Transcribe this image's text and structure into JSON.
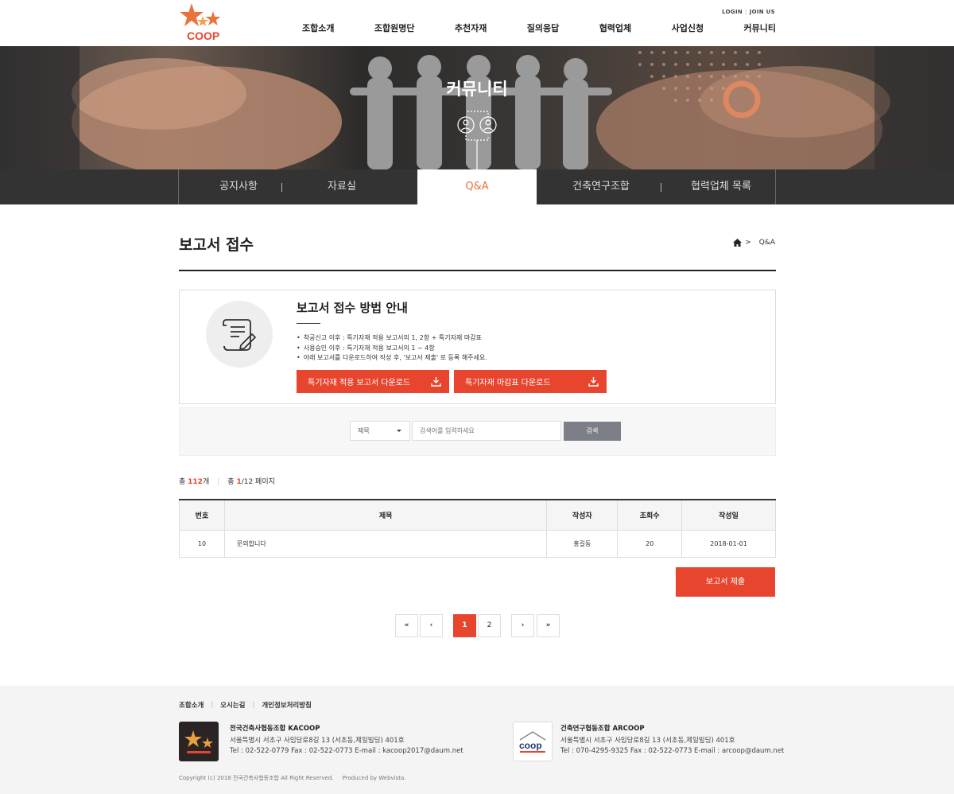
{
  "header": {
    "login": "LOGIN",
    "join": "JOIN US",
    "logo_text": "COOP",
    "nav": [
      "조합소개",
      "조합원명단",
      "추천자재",
      "질의응답",
      "협력업체",
      "사업신청",
      "커뮤니티"
    ]
  },
  "hero": {
    "title": "커뮤니티"
  },
  "subnav": {
    "tabs": [
      "공지사항",
      "자료실",
      "Q&A",
      "건축연구조합",
      "협력업체 목록"
    ],
    "active_index": 2
  },
  "page": {
    "title": "보고서 접수",
    "breadcrumb_sep": ">",
    "breadcrumb_current": "Q&A"
  },
  "guide": {
    "title": "보고서 접수 방법 안내",
    "items": [
      "착공신고 이후 : 특기자재 적용 보고서의 1, 2항 + 특기자재 마감표",
      "사용승인 이후 : 특기자재 적용 보고서의 1 ~ 4항",
      "아래 보고서를 다운로드하여 작성 후, '보고서 제출' 로 등록 해주세요."
    ],
    "download1": "특기자재 적용 보고서 다운로드",
    "download2": "특기자재 마감표 다운로드"
  },
  "search": {
    "select_value": "제목",
    "placeholder": "검색어를 입력하세요",
    "button": "검색"
  },
  "count": {
    "total_prefix": "총 ",
    "total": "112",
    "total_suffix": "개",
    "page_prefix": "총 ",
    "current_page": "1",
    "page_rest": "/12 페이지"
  },
  "table": {
    "headers": [
      "번호",
      "제목",
      "작성자",
      "조회수",
      "작성일"
    ],
    "rows": [
      {
        "no": "10",
        "subject": "문의합니다",
        "author": "홍길동",
        "views": "20",
        "date": "2018-01-01"
      }
    ]
  },
  "submit_button": "보고서 제출",
  "pagination": {
    "first": "«",
    "prev": "‹",
    "pages": [
      "1",
      "2"
    ],
    "current": "1",
    "next": "›",
    "last": "»"
  },
  "footer": {
    "links": [
      "조합소개",
      "오시는길",
      "개인정보처리방침"
    ],
    "org1": {
      "name": "전국건축사협동조합  KACOOP",
      "address": "서울특별시 서초구 사임당로8길 13 (서초동,제일빌딩) 401호",
      "contact": "Tel : 02-522-0779  Fax : 02-522-0773  E-mail : kacoop2017@daum.net"
    },
    "org2": {
      "name": "건축연구협동조합  ARCOOP",
      "logo_text": "coop",
      "address": "서울특별시 서초구 사임당로8길 13 (서초동,제일빌딩) 401호",
      "contact": "Tel : 070-4295-9325  Fax : 02-522-0773  E-mail :  arcoop@daum.net"
    },
    "copyright": "Copyright (c) 2018 전국건축사협동조합 All Right Reserved.     Produced by Webvista."
  },
  "colors": {
    "accent": "#e8452f",
    "active_tab_text": "#e8743b",
    "subnav_bg": "#333333",
    "search_button": "#7c7f87"
  }
}
